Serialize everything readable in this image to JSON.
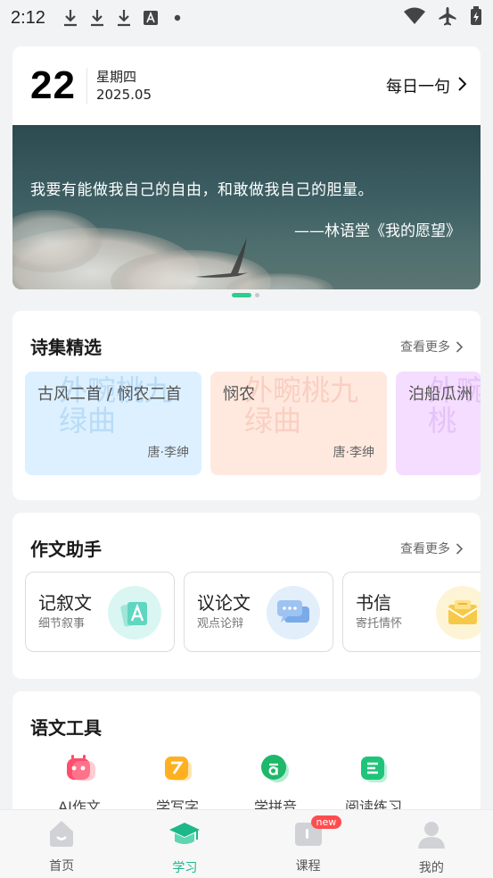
{
  "status_bar": {
    "time": "2:12"
  },
  "daily": {
    "day": "22",
    "weekday": "星期四",
    "year_month": "2025.05",
    "link_label": "每日一句",
    "quote": "我要有能做我自己的自由，和敢做我自己的胆量。",
    "source": "——林语堂《我的愿望》"
  },
  "poems": {
    "title": "诗集精选",
    "more": "查看更多",
    "items": [
      {
        "title": "古风二首 / 悯农二首",
        "author": "唐·李绅",
        "deco": "外畹桃九绿曲"
      },
      {
        "title": "悯农",
        "author": "唐·李绅",
        "deco": "外畹桃九绿曲"
      },
      {
        "title": "泊船瓜洲",
        "author": "",
        "deco": "外畹桃"
      }
    ]
  },
  "writing": {
    "title": "作文助手",
    "more": "查看更多",
    "items": [
      {
        "title": "记叙文",
        "subtitle": "细节叙事",
        "color": "#d9f6f2"
      },
      {
        "title": "议论文",
        "subtitle": "观点论辩",
        "color": "#e3eefb"
      },
      {
        "title": "书信",
        "subtitle": "寄托情怀",
        "color": "#fdf4d6"
      }
    ]
  },
  "tools": {
    "title": "语文工具",
    "items": [
      {
        "label": "AI作文",
        "color": "#ff4d6d"
      },
      {
        "label": "学写字",
        "color": "#ffb020"
      },
      {
        "label": "学拼音",
        "color": "#1db86a"
      },
      {
        "label": "阅读练习",
        "color": "#1fc47a"
      }
    ]
  },
  "tabbar": {
    "items": [
      {
        "label": "首页"
      },
      {
        "label": "学习"
      },
      {
        "label": "课程",
        "badge": "new"
      },
      {
        "label": "我的"
      }
    ]
  },
  "colors": {
    "accent": "#1db88a"
  }
}
